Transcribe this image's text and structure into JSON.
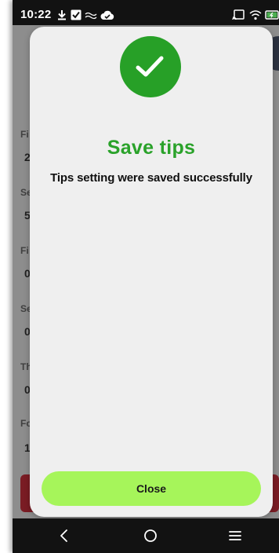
{
  "status_bar": {
    "time": "10:22",
    "left_icons": [
      "download-icon",
      "check-square-icon",
      "wave-icon",
      "cloud-check-icon"
    ],
    "right_icons": [
      "cast-icon",
      "wifi-icon",
      "battery-charging-icon"
    ]
  },
  "background": {
    "rows": [
      {
        "label": "Fi",
        "value": "2"
      },
      {
        "label": "Se",
        "value": "5"
      },
      {
        "label": "Fi",
        "value": "0"
      },
      {
        "label": "Se",
        "value": "0"
      },
      {
        "label": "Th",
        "value": "0"
      },
      {
        "label": "Fo",
        "value": "1"
      }
    ]
  },
  "modal": {
    "icon": "checkmark-icon",
    "title": "Save tips",
    "message": "Tips setting were saved successfully",
    "close_label": "Close"
  },
  "nav_bar": {
    "buttons": [
      "back-icon",
      "home-icon",
      "menu-icon"
    ]
  },
  "colors": {
    "success_green": "#27a027",
    "title_green": "#2aa22a",
    "close_button": "#a6f55a",
    "modal_bg": "#efefef",
    "status_bar_bg": "#121212"
  }
}
